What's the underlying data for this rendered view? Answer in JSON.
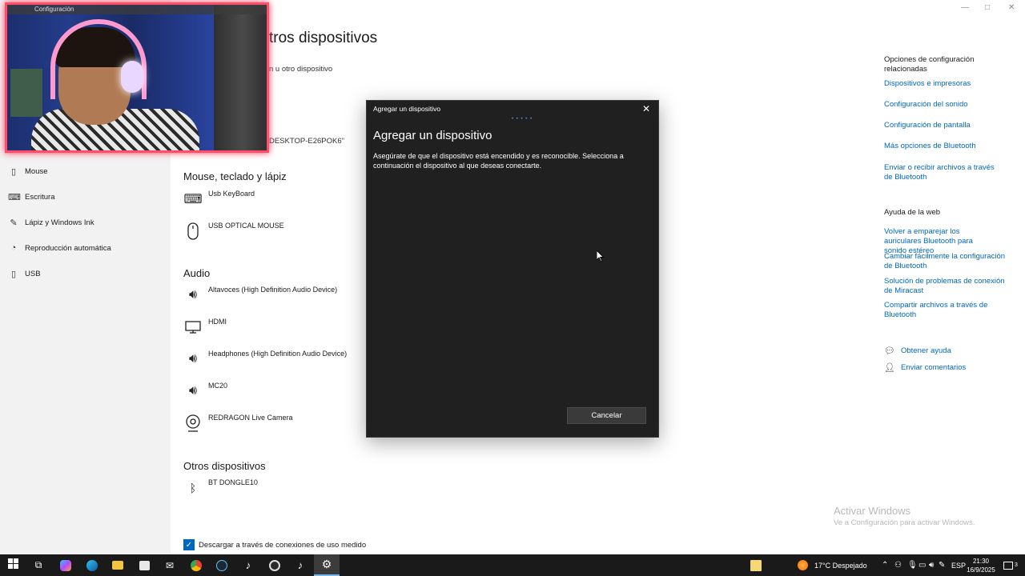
{
  "window": {
    "title": "Configuración",
    "min": "—",
    "max": "□",
    "close": "✕"
  },
  "main": {
    "heading_partial": "tros dispositivos",
    "add_device_partial": "n u otro dispositivo",
    "desktop_name_partial": "DESKTOP-E26POK6\""
  },
  "sidebar": {
    "items": [
      {
        "label": "Mouse",
        "icon": "mouse-icon"
      },
      {
        "label": "Escritura",
        "icon": "keyboard-icon"
      },
      {
        "label": "Lápiz y Windows Ink",
        "icon": "pen-icon"
      },
      {
        "label": "Reproducción automática",
        "icon": "autoplay-icon"
      },
      {
        "label": "USB",
        "icon": "usb-icon"
      }
    ]
  },
  "sections": {
    "mouse_keyboard": {
      "title": "Mouse, teclado y lápiz",
      "devices": [
        {
          "name": "Usb KeyBoard",
          "icon": "keyboard-icon"
        },
        {
          "name": "USB OPTICAL MOUSE",
          "icon": "mouse-icon"
        }
      ]
    },
    "audio": {
      "title": "Audio",
      "devices": [
        {
          "name": "Altavoces (High Definition Audio Device)",
          "icon": "speaker-icon"
        },
        {
          "name": "HDMI",
          "icon": "monitor-icon"
        },
        {
          "name": "Headphones (High Definition Audio Device)",
          "icon": "speaker-icon"
        },
        {
          "name": "MC20",
          "icon": "speaker-icon"
        },
        {
          "name": "REDRAGON  Live Camera",
          "icon": "webcam-icon"
        }
      ]
    },
    "other": {
      "title": "Otros dispositivos",
      "devices": [
        {
          "name": "BT DONGLE10",
          "icon": "bluetooth-icon"
        }
      ]
    }
  },
  "metered_checkbox": {
    "label": "Descargar a través de conexiones de uso medido",
    "checked": true
  },
  "right_panel": {
    "related_heading": "Opciones de configuración relacionadas",
    "related_links": [
      "Dispositivos e impresoras",
      "Configuración del sonido",
      "Configuración de pantalla",
      "Más opciones de Bluetooth",
      "Enviar o recibir archivos a través de Bluetooth"
    ],
    "web_help_heading": "Ayuda de la web",
    "web_links": [
      "Volver a emparejar los auriculares Bluetooth para sonido estéreo",
      "Cambiar fácilmente la configuración de Bluetooth",
      "Solución de problemas de conexión de Miracast",
      "Compartir archivos a través de Bluetooth"
    ],
    "get_help": "Obtener ayuda",
    "feedback": "Enviar comentarios"
  },
  "activation": {
    "title": "Activar Windows",
    "subtitle": "Ve a Configuración para activar Windows."
  },
  "dialog": {
    "title": "Agregar un dispositivo",
    "heading": "Agregar un dispositivo",
    "description": "Asegúrate de que el dispositivo está encendido y es reconocible. Selecciona a continuación el dispositivo al que deseas conectarte.",
    "cancel": "Cancelar",
    "close": "✕",
    "progress": "• • • • •"
  },
  "taskbar": {
    "weather": "17°C  Despejado",
    "language": "ESP",
    "time": "21:30",
    "date": "16/9/2025",
    "notification_count": "3",
    "accent": "#76b9ed"
  }
}
